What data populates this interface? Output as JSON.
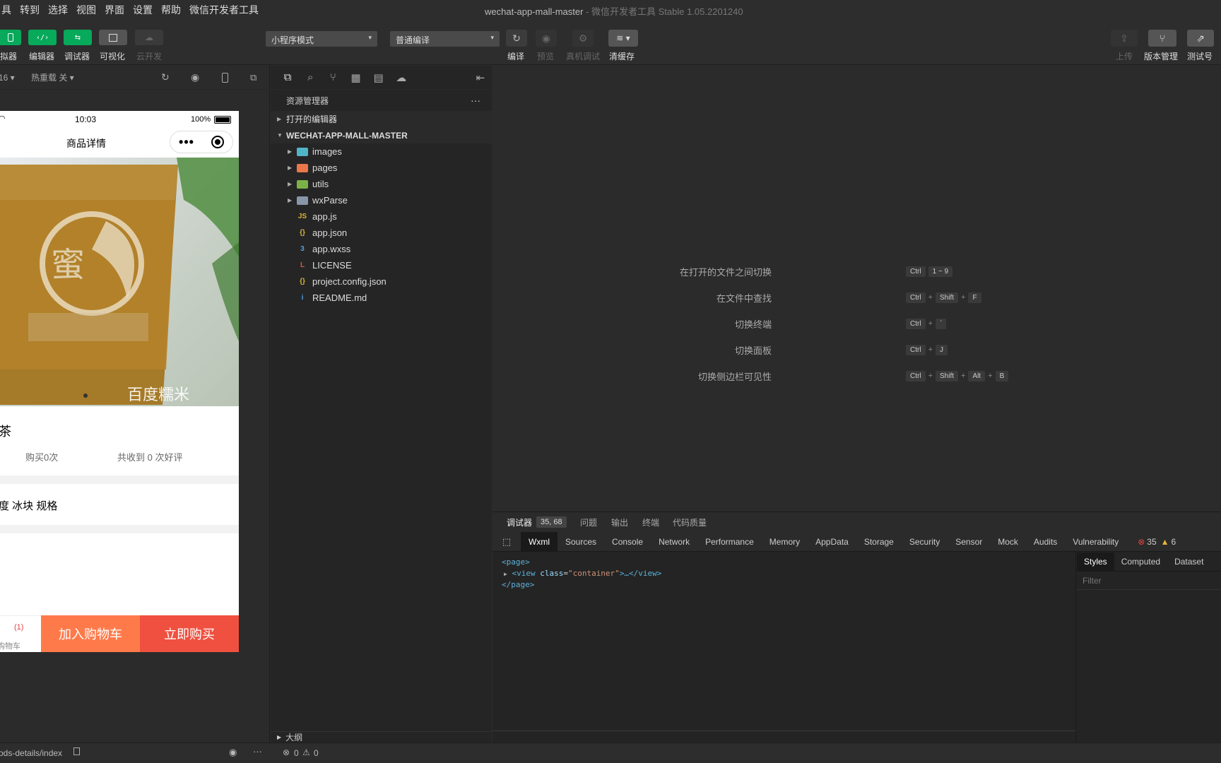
{
  "menubar": {
    "items": [
      "具",
      "转到",
      "选择",
      "视图",
      "界面",
      "设置",
      "帮助",
      "微信开发者工具"
    ],
    "title": "wechat-app-mall-master",
    "title_sep": " - ",
    "title_sub": "微信开发者工具 Stable 1.05.2201240"
  },
  "toolbar": {
    "simulator_label": "拟器",
    "editor_label": "编辑器",
    "debugger_label": "调试器",
    "visual_label": "可视化",
    "cloud_label": "云开发",
    "mode_select": "小程序模式",
    "compile_select": "普通编译",
    "compile_label": "编译",
    "preview_label": "预览",
    "realdebug_label": "真机调试",
    "clearcache_label": "清缓存",
    "upload_label": "上传",
    "version_label": "版本管理",
    "test_label": "测试号"
  },
  "simulator": {
    "zoom": "16 ▾",
    "hotreload": "热重载 关 ▾",
    "time": "10:03",
    "battery": "100%",
    "page_title": "商品详情",
    "watermark": "百度糯米",
    "product_title": "茶",
    "bought": "购买0次",
    "reviews": "共收到 0 次好评",
    "spec": "度 冰块 规格",
    "cart_count": "(1)",
    "cart_label": "购物车",
    "add_cart": "加入购物车",
    "buy_now": "立即购买"
  },
  "explorer": {
    "title": "资源管理器",
    "more": "···",
    "open_editors": "打开的编辑器",
    "project": "WECHAT-APP-MALL-MASTER",
    "files": [
      {
        "name": "images",
        "type": "folder",
        "color": "#4fb5c7"
      },
      {
        "name": "pages",
        "type": "folder",
        "color": "#e9774a"
      },
      {
        "name": "utils",
        "type": "folder",
        "color": "#7bb247"
      },
      {
        "name": "wxParse",
        "type": "folder",
        "color": "#8896a8"
      },
      {
        "name": "app.js",
        "type": "file",
        "icon": "JS",
        "color": "#d8b334"
      },
      {
        "name": "app.json",
        "type": "file",
        "icon": "{}",
        "color": "#d8b334"
      },
      {
        "name": "app.wxss",
        "type": "file",
        "icon": "3",
        "color": "#4da0e0"
      },
      {
        "name": "LICENSE",
        "type": "file",
        "icon": "L",
        "color": "#e0573c"
      },
      {
        "name": "project.config.json",
        "type": "file",
        "icon": "{}",
        "color": "#d8b334"
      },
      {
        "name": "README.md",
        "type": "file",
        "icon": "i",
        "color": "#4da0e0"
      }
    ],
    "outline": "大纲"
  },
  "editor": {
    "shortcuts": [
      {
        "label": "在打开的文件之间切换",
        "keys": [
          "Ctrl",
          "1 ~ 9"
        ],
        "join": ""
      },
      {
        "label": "在文件中查找",
        "keys": [
          "Ctrl",
          "Shift",
          "F"
        ],
        "join": "+"
      },
      {
        "label": "切换终端",
        "keys": [
          "Ctrl",
          "`"
        ],
        "join": "+"
      },
      {
        "label": "切换面板",
        "keys": [
          "Ctrl",
          "J"
        ],
        "join": "+"
      },
      {
        "label": "切换侧边栏可见性",
        "keys": [
          "Ctrl",
          "Shift",
          "Alt",
          "B"
        ],
        "join": "+"
      }
    ]
  },
  "debugger": {
    "tabs": [
      "调试器",
      "问题",
      "输出",
      "终端",
      "代码质量"
    ],
    "badge": "35, 68",
    "devtools_tabs": [
      "Wxml",
      "Sources",
      "Console",
      "Network",
      "Performance",
      "Memory",
      "AppData",
      "Storage",
      "Security",
      "Sensor",
      "Mock",
      "Audits",
      "Vulnerability"
    ],
    "errors": "35",
    "warnings": "6",
    "code_page_open": "<page>",
    "code_view_open": "<view ",
    "code_attr": "class",
    "code_eq": "=",
    "code_val": "\"container\"",
    "code_view_close": ">…</view>",
    "code_page_close": "</page>",
    "side_tabs": [
      "Styles",
      "Computed",
      "Dataset"
    ],
    "filter_placeholder": "Filter"
  },
  "status": {
    "path": "ods-details/index",
    "errors": "0",
    "warnings": "0"
  }
}
